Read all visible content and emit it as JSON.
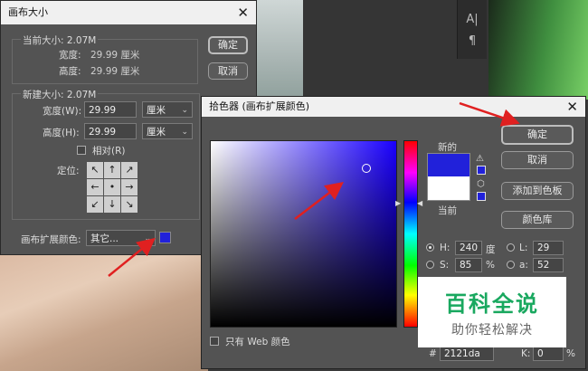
{
  "background": {
    "tool_glyphs": [
      "A|",
      "¶"
    ]
  },
  "canvas_dialog": {
    "title": "画布大小",
    "current_size_label": "当前大小: 2.07M",
    "current_width_label": "宽度:",
    "current_width_value": "29.99 厘米",
    "current_height_label": "高度:",
    "current_height_value": "29.99 厘米",
    "new_size_label": "新建大小: 2.07M",
    "width_label": "宽度(W):",
    "width_value": "29.99",
    "width_unit": "厘米",
    "height_label": "高度(H):",
    "height_value": "29.99",
    "height_unit": "厘米",
    "relative_label": "相对(R)",
    "anchor_label": "定位:",
    "anchor_arrows": [
      "↖",
      "↑",
      "↗",
      "←",
      "•",
      "→",
      "↙",
      "↓",
      "↘"
    ],
    "extension_color_label": "画布扩展颜色:",
    "extension_color_value": "其它...",
    "ok_button": "确定",
    "cancel_button": "取消",
    "extension_color": "#2121da"
  },
  "color_picker": {
    "title": "拾色器 (画布扩展颜色)",
    "new_label": "新的",
    "current_label": "当前",
    "ok_button": "确定",
    "cancel_button": "取消",
    "add_swatch_button": "添加到色板",
    "color_library_button": "颜色库",
    "web_only_label": "只有 Web 颜色",
    "h_label": "H:",
    "h_value": "240",
    "h_unit": "度",
    "s_label": "S:",
    "s_value": "85",
    "s_unit": "%",
    "l_label": "L:",
    "l_value": "29",
    "a_label": "a:",
    "a_value": "52",
    "k_label": "K:",
    "k_value": "0",
    "k_unit": "%",
    "hex_label": "#",
    "hex_value": "2121da",
    "new_color": "#2121da",
    "current_color": "#ffffff"
  },
  "watermark": {
    "title": "百科全说",
    "subtitle": "助你轻松解决"
  },
  "annotation_color": "#e02020"
}
